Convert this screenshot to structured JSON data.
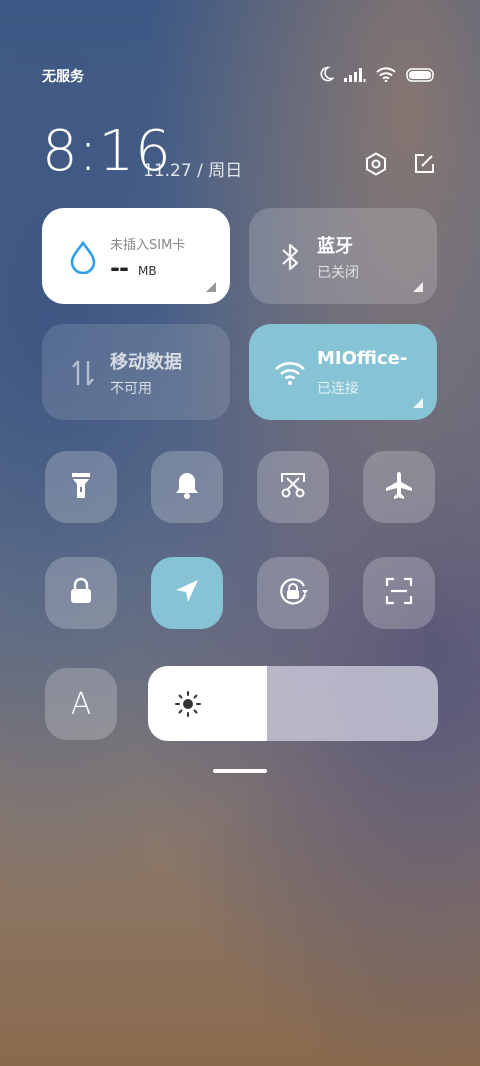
{
  "status": {
    "carrier": "无服务"
  },
  "header": {
    "time": "8:16",
    "date": "11.27 / 周日"
  },
  "tiles": {
    "data_usage": {
      "title": "未插入SIM卡",
      "value": "--",
      "unit": "MB"
    },
    "bluetooth": {
      "title": "蓝牙",
      "subtitle": "已关闭"
    },
    "mobile_data": {
      "title": "移动数据",
      "subtitle": "不可用"
    },
    "wifi": {
      "title": "MIOffice-",
      "subtitle": "已连接"
    }
  },
  "toggles": [
    "flashlight-icon",
    "bell-icon",
    "screenshot-icon",
    "airplane-icon",
    "lock-icon",
    "location-icon",
    "rotation-lock-icon",
    "scan-icon",
    "auto-brightness-icon"
  ],
  "auto_brightness_label": "A",
  "brightness": {
    "level": 0.41
  },
  "colors": {
    "accent": "#86c3d5",
    "tile": "rgba(255,255,255,0.18)"
  }
}
